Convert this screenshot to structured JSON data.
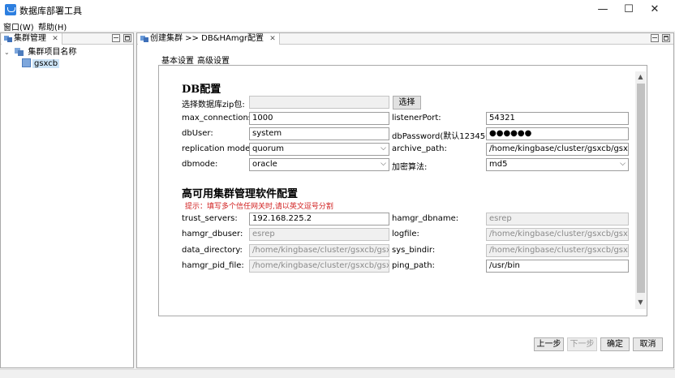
{
  "window": {
    "title": "数据库部署工具",
    "minimize_glyph": "—",
    "maximize_glyph": "☐",
    "close_glyph": "✕"
  },
  "menu": {
    "items": [
      "窗口(W)",
      "帮助(H)"
    ]
  },
  "cluster_view": {
    "tab_label": "集群管理",
    "tab_close": "✕",
    "tree": {
      "root_label": "集群项目名称",
      "children": [
        "gsxcb"
      ]
    }
  },
  "editor": {
    "tab_label": "创建集群 >> DB&HAmgr配置",
    "tab_close": "✕",
    "inner_tabs": [
      "基本设置",
      "高级设置"
    ]
  },
  "db_section": {
    "title": "DB配置",
    "zip_label": "选择数据库zip包:",
    "zip_value": "",
    "browse_button": "选择",
    "fields_left": [
      {
        "label": "max_connections:",
        "value": "1000",
        "kind": "text"
      },
      {
        "label": "dbUser:",
        "value": "system",
        "kind": "text"
      },
      {
        "label": "replication mode:",
        "value": "quorum",
        "kind": "combo"
      },
      {
        "label": "dbmode:",
        "value": "oracle",
        "kind": "combo"
      }
    ],
    "fields_right": [
      {
        "label": "listenerPort:",
        "value": "54321",
        "kind": "text"
      },
      {
        "label": "dbPassword(默认123456):",
        "value": "●●●●●●",
        "kind": "password"
      },
      {
        "label": "archive_path:",
        "value": "/home/kingbase/cluster/gsxcb/gsxcb",
        "kind": "text"
      },
      {
        "label": "加密算法:",
        "value": "md5",
        "kind": "combo"
      }
    ]
  },
  "ha_section": {
    "title": "高可用集群管理软件配置",
    "hint": "提示：填写多个信任网关时,请以英文逗号分割",
    "fields_left": [
      {
        "label": "trust_servers:",
        "value": "192.168.225.2",
        "kind": "text"
      },
      {
        "label": "hamgr_dbuser:",
        "value": "esrep",
        "kind": "disabled"
      },
      {
        "label": "data_directory:",
        "value": "/home/kingbase/cluster/gsxcb/gsxcb",
        "kind": "disabled"
      },
      {
        "label": "hamgr_pid_file:",
        "value": "/home/kingbase/cluster/gsxcb/gsxcb",
        "kind": "disabled"
      }
    ],
    "fields_right": [
      {
        "label": "hamgr_dbname:",
        "value": "esrep",
        "kind": "disabled"
      },
      {
        "label": "logfile:",
        "value": "/home/kingbase/cluster/gsxcb/gsxcb",
        "kind": "disabled"
      },
      {
        "label": "sys_bindir:",
        "value": "/home/kingbase/cluster/gsxcb/gsxcb",
        "kind": "disabled"
      },
      {
        "label": "ping_path:",
        "value": "/usr/bin",
        "kind": "text"
      }
    ]
  },
  "wizard_buttons": {
    "prev": "上一步",
    "next": "下一步",
    "finish": "确定",
    "cancel": "取消"
  },
  "icons": {
    "app": "app-logo-icon",
    "tree_root": "cluster-folder-icon",
    "tree_leaf": "cluster-node-icon"
  }
}
